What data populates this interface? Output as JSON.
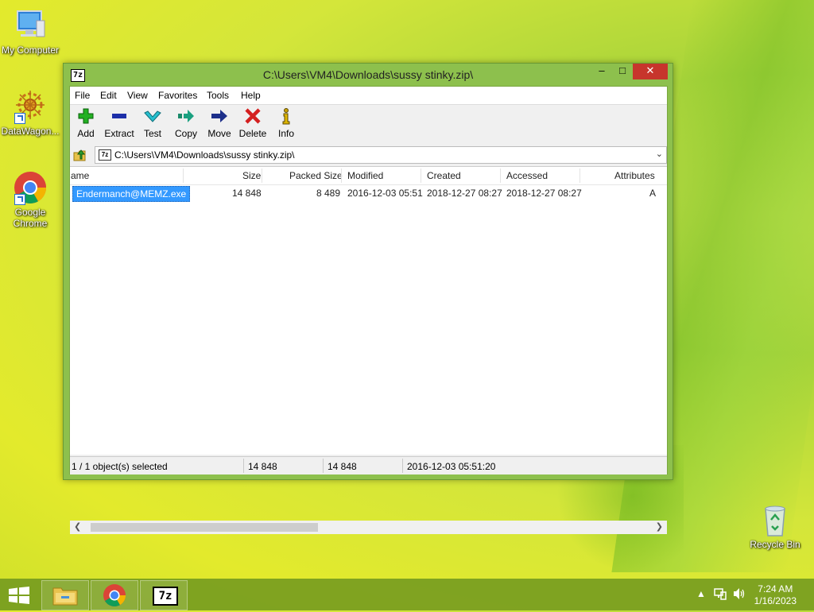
{
  "desktop": {
    "icons": [
      {
        "label": "My Computer"
      },
      {
        "label": "DataWagon..."
      },
      {
        "label": "Google\nChrome",
        "line1": "Google",
        "line2": "Chrome"
      },
      {
        "label": "Recycle Bin"
      }
    ]
  },
  "window": {
    "title": "C:\\Users\\VM4\\Downloads\\sussy stinky.zip\\",
    "app_icon": "7z",
    "controls": {
      "minimize": "–",
      "maximize": "□",
      "close": "✕"
    },
    "menu": [
      "File",
      "Edit",
      "View",
      "Favorites",
      "Tools",
      "Help"
    ],
    "toolbar": [
      {
        "label": "Add",
        "icon": "plus-icon",
        "color": "#1fa01f"
      },
      {
        "label": "Extract",
        "icon": "minus-icon",
        "color": "#1d2fa8"
      },
      {
        "label": "Test",
        "icon": "check-icon",
        "color": "#20b8c8"
      },
      {
        "label": "Copy",
        "icon": "double-arrow-icon",
        "color": "#1a8a6a"
      },
      {
        "label": "Move",
        "icon": "arrow-right-icon",
        "color": "#1d2f8a"
      },
      {
        "label": "Delete",
        "icon": "x-icon",
        "color": "#d41f1f"
      },
      {
        "label": "Info",
        "icon": "info-icon",
        "color": "#c8a000"
      }
    ],
    "address": "C:\\Users\\VM4\\Downloads\\sussy stinky.zip\\",
    "columns": [
      "ame",
      "Size",
      "Packed Size",
      "Modified",
      "Created",
      "Accessed",
      "Attributes"
    ],
    "rows": [
      {
        "name": "Endermanch@MEMZ.exe",
        "size": "14 848",
        "packed": "8 489",
        "modified": "2016-12-03 05:51",
        "created": "2018-12-27 08:27",
        "accessed": "2018-12-27 08:27",
        "attributes": "A"
      }
    ],
    "status": {
      "selected": "1 / 1 object(s) selected",
      "size": "14 848",
      "packed": "14 848",
      "date": "2016-12-03 05:51:20"
    }
  },
  "taskbar": {
    "time": "7:24 AM",
    "date": "1/16/2023",
    "apps": [
      "file-explorer",
      "google-chrome",
      "7-zip"
    ],
    "seven_zip_label": "7z"
  }
}
